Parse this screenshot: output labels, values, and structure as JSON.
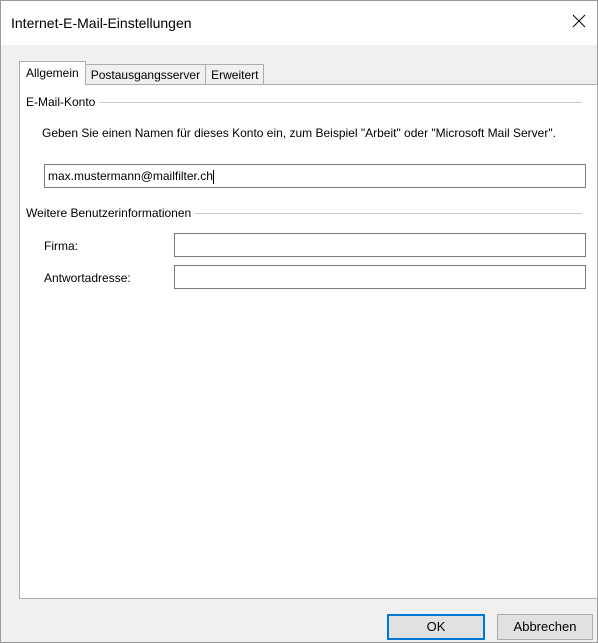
{
  "window": {
    "title": "Internet-E-Mail-Einstellungen"
  },
  "tabs": [
    {
      "label": "Allgemein",
      "active": true
    },
    {
      "label": "Postausgangsserver",
      "active": false
    },
    {
      "label": "Erweitert",
      "active": false
    }
  ],
  "email_account": {
    "group_label": "E-Mail-Konto",
    "description": "Geben Sie einen Namen für dieses Konto ein, zum Beispiel \"Arbeit\" oder \"Microsoft Mail Server\".",
    "account_name_value": "max.mustermann@mailfilter.ch"
  },
  "user_info": {
    "group_label": "Weitere Benutzerinformationen",
    "company_label": "Firma:",
    "company_value": "",
    "reply_label": "Antwortadresse:",
    "reply_value": ""
  },
  "buttons": {
    "ok_label": "OK",
    "cancel_label": "Abbrechen"
  },
  "colors": {
    "accent": "#0078d7",
    "dialog_bg": "#f0f0f0",
    "panel_bg": "#ffffff"
  }
}
